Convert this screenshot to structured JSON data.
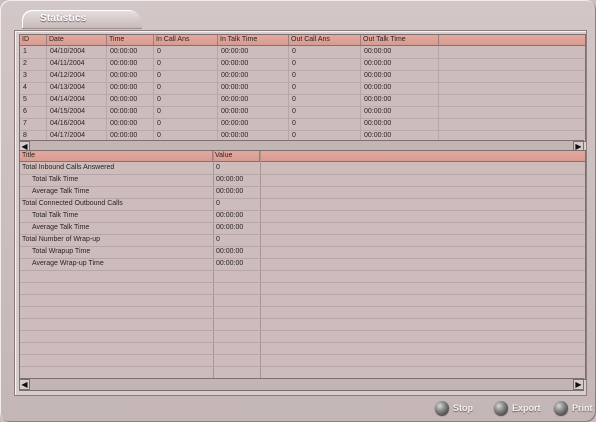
{
  "title": "Statistics",
  "daily_table": {
    "columns": [
      "ID",
      "Date",
      "Time",
      "In Call Ans",
      "In Talk Time",
      "Out Call Ans",
      "Out Talk Time"
    ],
    "rows": [
      [
        "1",
        "04/10/2004",
        "00:00:00",
        "0",
        "00:00:00",
        "0",
        "00:00:00"
      ],
      [
        "2",
        "04/11/2004",
        "00:00:00",
        "0",
        "00:00:00",
        "0",
        "00:00:00"
      ],
      [
        "3",
        "04/12/2004",
        "00:00:00",
        "0",
        "00:00:00",
        "0",
        "00:00:00"
      ],
      [
        "4",
        "04/13/2004",
        "00:00:00",
        "0",
        "00:00:00",
        "0",
        "00:00:00"
      ],
      [
        "5",
        "04/14/2004",
        "00:00:00",
        "0",
        "00:00:00",
        "0",
        "00:00:00"
      ],
      [
        "6",
        "04/15/2004",
        "00:00:00",
        "0",
        "00:00:00",
        "0",
        "00:00:00"
      ],
      [
        "7",
        "04/16/2004",
        "00:00:00",
        "0",
        "00:00:00",
        "0",
        "00:00:00"
      ],
      [
        "8",
        "04/17/2004",
        "00:00:00",
        "0",
        "00:00:00",
        "0",
        "00:00:00"
      ]
    ]
  },
  "summary_table": {
    "columns": [
      "Title",
      "Value"
    ],
    "rows": [
      {
        "title": "Total Inbound Calls Answered",
        "value": "0"
      },
      {
        "title": "Total Talk Time",
        "value": "00:00:00"
      },
      {
        "title": "Average Talk Time",
        "value": "00:00:00"
      },
      {
        "title": "Total Connected Outbound Calls",
        "value": "0"
      },
      {
        "title": "Total Talk Time",
        "value": "00:00:00"
      },
      {
        "title": "Average Talk Time",
        "value": "00:00:00"
      },
      {
        "title": "Total Number of Wrap-up",
        "value": "0"
      },
      {
        "title": "Total Wrapup Time",
        "value": "00:00:00"
      },
      {
        "title": "Average Wrap-up Time",
        "value": "00:00:00"
      }
    ]
  },
  "buttons": {
    "stop": "Stop",
    "export": "Export",
    "print": "Print"
  },
  "icons": {
    "scroll_left": "◀",
    "scroll_right": "▶"
  }
}
